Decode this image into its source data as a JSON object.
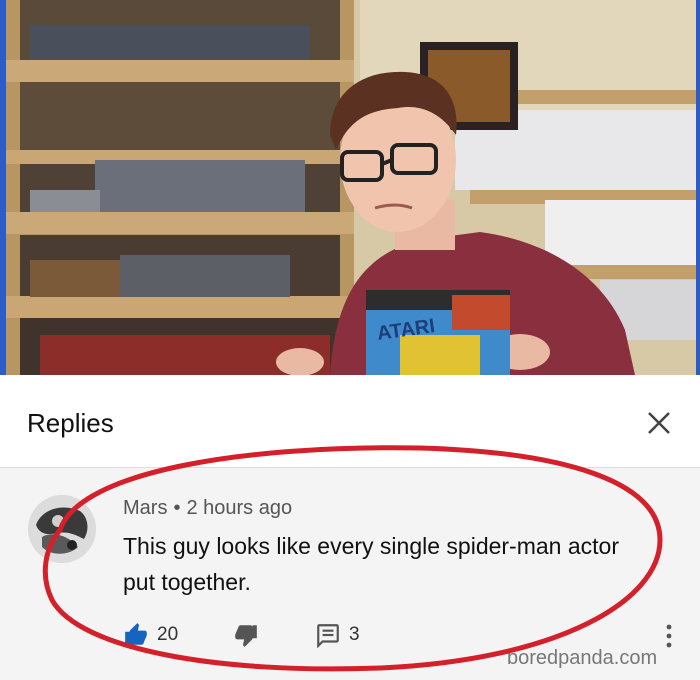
{
  "panel": {
    "title": "Replies",
    "close_icon": "close-icon"
  },
  "comment": {
    "author": "Mars",
    "separator": "•",
    "time": "2 hours ago",
    "text": "This guy looks like every single spider-man actor put together.",
    "likes": "20",
    "replies": "3",
    "icons": [
      "thumbs-up-icon",
      "thumbs-down-icon",
      "comment-icon",
      "more-vert-icon"
    ]
  },
  "video_frame": {
    "game_box_label": "ATARI"
  },
  "watermark": "boredpanda.com",
  "colors": {
    "accent_blue": "#1565c0",
    "annotation_red": "#d3202a",
    "frame_blue": "#2b5cc8"
  }
}
